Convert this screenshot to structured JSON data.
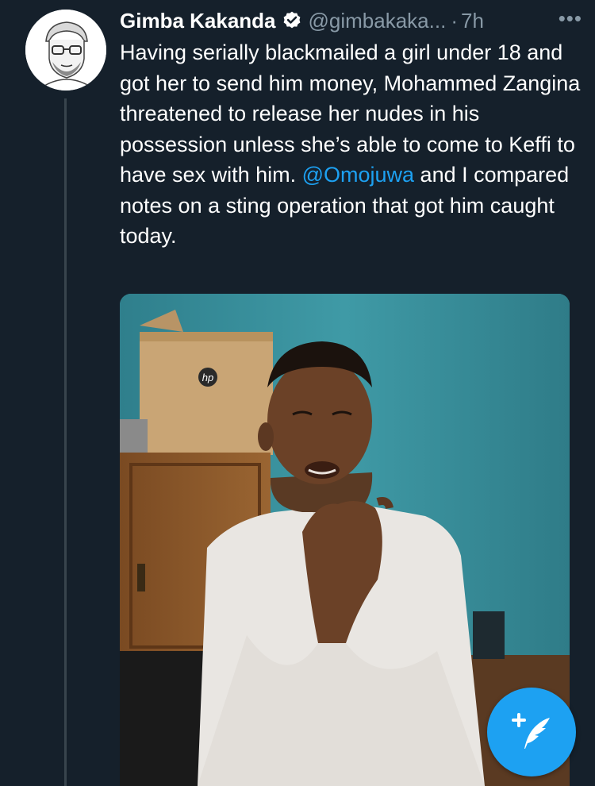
{
  "tweet": {
    "author_name": "Gimba Kakanda",
    "handle": "@gimbakaka...",
    "separator": "·",
    "time": "7h",
    "more_label": "•••",
    "text_before": "Having serially blackmailed a girl under 18 and got her to send him money, Mohammed Zangina threatened to release her nudes in his possession unless she’s able to come to Keffi to have sex with him. ",
    "mention": "@Omojuwa",
    "text_after": " and I compared notes on a sting operation that got him caught today."
  },
  "photo": {
    "box_logo": "hp"
  },
  "icons": {
    "verified": "verified-badge-icon",
    "compose": "compose-tweet-icon"
  },
  "colors": {
    "background": "#15202b",
    "accent": "#1da1f2",
    "secondary_text": "#8899a6"
  }
}
